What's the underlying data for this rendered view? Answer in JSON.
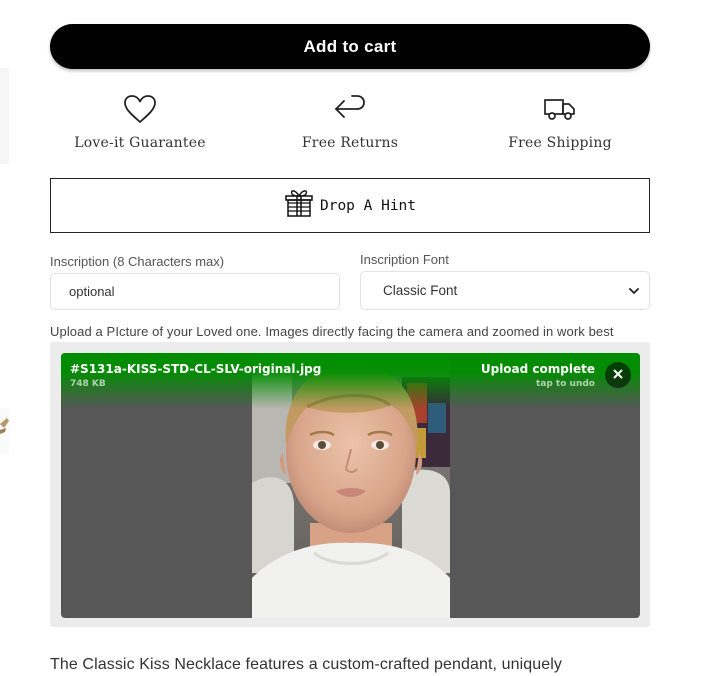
{
  "product": {
    "add_to_cart_label": "Add to cart",
    "features": [
      {
        "icon": "heart-icon",
        "label": "Love-it Guarantee"
      },
      {
        "icon": "return-arrow-icon",
        "label": "Free Returns"
      },
      {
        "icon": "truck-icon",
        "label": "Free Shipping"
      }
    ],
    "hint_label": "Drop A Hint",
    "description": "The Classic Kiss Necklace features a custom-crafted pendant, uniquely"
  },
  "form": {
    "inscription_label": "Inscription (8 Characters max)",
    "inscription_placeholder": "optional",
    "font_label": "Inscription Font",
    "font_selected": "Classic Font",
    "upload_note": "Upload a PIcture of your Loved one. Images directly facing the camera and zoomed in work best"
  },
  "upload": {
    "file_name": "#S131a-KISS-STD-CL-SLV-original.jpg",
    "file_size": "748 KB",
    "status": "Upload complete",
    "undo_hint": "tap to undo"
  },
  "colors": {
    "button_bg": "#000000",
    "upload_success": "#008e00",
    "file_panel": "#575757"
  }
}
